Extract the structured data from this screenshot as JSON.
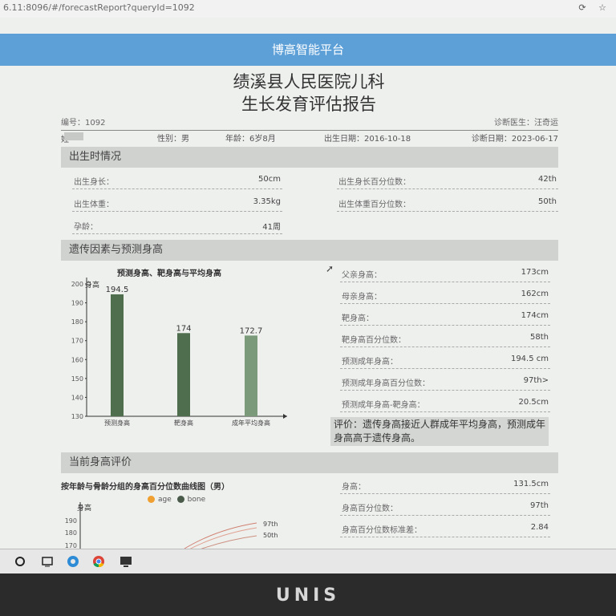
{
  "browser": {
    "url": "6.11:8096/#/forecastReport?queryId=1092",
    "tools": "⟳ ☆"
  },
  "platform_title": "博高智能平台",
  "report": {
    "title_line1": "绩溪县人民医院儿科",
    "title_line2": "生长发育评估报告",
    "number": "编号：1092",
    "doctor": "诊断医生：汪奇运",
    "name_label": "姓名",
    "sex": "性别：男",
    "age": "年龄：6岁8月",
    "birth_date": "出生日期：2016-10-18",
    "diag_date": "诊断日期：2023-06-17"
  },
  "birth_section": {
    "title": "出生时情况",
    "rows": [
      {
        "label": "出生身长：",
        "value": "50cm"
      },
      {
        "label": "出生身长百分位数：",
        "value": "42th"
      },
      {
        "label": "出生体重：",
        "value": "3.35kg"
      },
      {
        "label": "出生体重百分位数：",
        "value": "50th"
      },
      {
        "label": "孕龄：",
        "value": "41周"
      }
    ]
  },
  "genetic_section": {
    "title": "遗传因素与预测身高",
    "chart_title": "预测身高、靶身高与平均身高",
    "rows": [
      {
        "label": "父亲身高：",
        "value": "173cm"
      },
      {
        "label": "母亲身高：",
        "value": "162cm"
      },
      {
        "label": "靶身高：",
        "value": "174cm"
      },
      {
        "label": "靶身高百分位数：",
        "value": "58th"
      },
      {
        "label": "预测成年身高：",
        "value": "194.5 cm"
      },
      {
        "label": "预测成年身高百分位数：",
        "value": "97th>"
      },
      {
        "label": "预测成年身高-靶身高：",
        "value": "20.5cm"
      }
    ],
    "evaluation": "评价：遗传身高接近人群成年平均身高，预测成年身高高于遗传身高。"
  },
  "current_section": {
    "title": "当前身高评价",
    "chart_title": "按年龄与骨龄分组的身高百分位数曲线图（男）",
    "legend_age": "age",
    "legend_bone": "bone",
    "rows": [
      {
        "label": "身高：",
        "value": "131.5cm"
      },
      {
        "label": "身高百分位数：",
        "value": "97th"
      },
      {
        "label": "身高百分位数标准差：",
        "value": "2.84"
      }
    ]
  },
  "chart_data": [
    {
      "type": "bar",
      "title": "预测身高、靶身高与平均身高",
      "ylabel": "身高",
      "ylim": [
        130,
        200
      ],
      "yticks": [
        130,
        140,
        150,
        160,
        170,
        180,
        190,
        200
      ],
      "categories": [
        "预测身高",
        "靶身高",
        "成年平均身高"
      ],
      "values": [
        194.5,
        174,
        172.7
      ],
      "colors": [
        "#4e6e4e",
        "#4e6e4e",
        "#7a9a7a"
      ]
    },
    {
      "type": "line",
      "title": "按年龄与骨龄分组的身高百分位数曲线图（男）",
      "ylabel": "身高",
      "yticks": [
        170,
        180,
        190
      ],
      "series": [
        {
          "name": "age",
          "color": "#f0a030"
        },
        {
          "name": "bone",
          "color": "#4a5a4a"
        }
      ],
      "percentile_labels": [
        "97th",
        "50th"
      ]
    }
  ],
  "taskbar": {
    "icons": [
      "start-circle-icon",
      "task-view-icon",
      "edge-browser-icon",
      "chrome-icon",
      "desktop-app-icon"
    ]
  },
  "bezel_brand": "UNIS",
  "colors": {
    "header_blue": "#5da0d8",
    "section_gray": "#cfd2cf",
    "bar_dark": "#4e6e4e",
    "bar_light": "#7a9a7a"
  }
}
